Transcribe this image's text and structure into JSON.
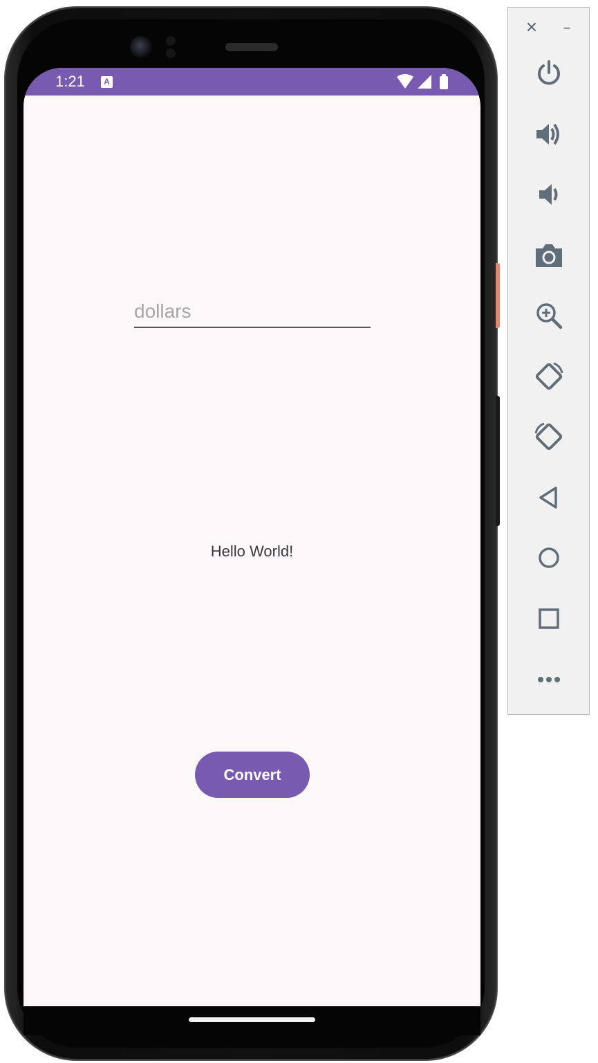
{
  "status_bar": {
    "time": "1:21",
    "app_icon_letter": "A"
  },
  "app": {
    "input_placeholder": "dollars",
    "input_value": "",
    "message": "Hello World!",
    "convert_label": "Convert"
  },
  "toolbar": {
    "close_symbol": "✕",
    "minimize_symbol": "–",
    "buttons": [
      {
        "icon": "power-icon"
      },
      {
        "icon": "volume-up-icon"
      },
      {
        "icon": "volume-down-icon"
      },
      {
        "icon": "camera-icon"
      },
      {
        "icon": "zoom-in-icon"
      },
      {
        "icon": "rotate-left-icon"
      },
      {
        "icon": "rotate-right-icon"
      },
      {
        "icon": "back-icon"
      },
      {
        "icon": "home-icon"
      },
      {
        "icon": "overview-icon"
      },
      {
        "icon": "more-icon"
      }
    ]
  },
  "colors": {
    "accent": "#785bb1",
    "screen_background": "#fcf8fa",
    "toolbar_icon": "#5f6e78"
  }
}
